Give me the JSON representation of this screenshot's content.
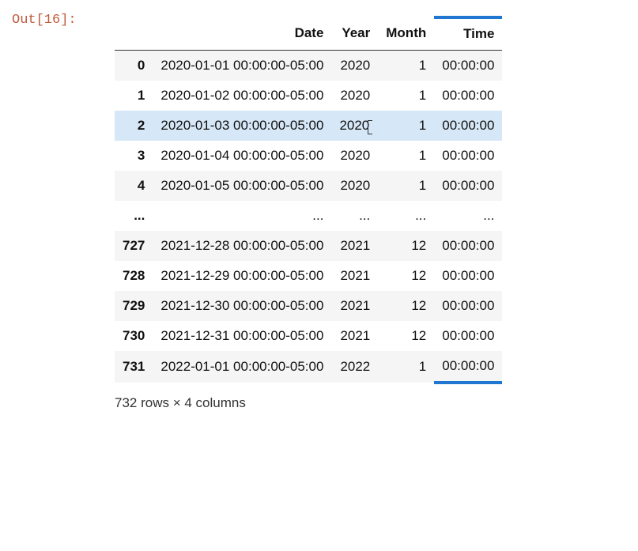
{
  "prompt": "Out[16]:",
  "chart_data": {
    "type": "table",
    "columns": [
      "",
      "Date",
      "Year",
      "Month",
      "Time"
    ],
    "rows": [
      {
        "idx": "0",
        "date": "2020-01-01 00:00:00-05:00",
        "year": "2020",
        "month": "1",
        "time": "00:00:00"
      },
      {
        "idx": "1",
        "date": "2020-01-02 00:00:00-05:00",
        "year": "2020",
        "month": "1",
        "time": "00:00:00"
      },
      {
        "idx": "2",
        "date": "2020-01-03 00:00:00-05:00",
        "year": "2020",
        "month": "1",
        "time": "00:00:00"
      },
      {
        "idx": "3",
        "date": "2020-01-04 00:00:00-05:00",
        "year": "2020",
        "month": "1",
        "time": "00:00:00"
      },
      {
        "idx": "4",
        "date": "2020-01-05 00:00:00-05:00",
        "year": "2020",
        "month": "1",
        "time": "00:00:00"
      },
      {
        "idx": "...",
        "date": "...",
        "year": "...",
        "month": "...",
        "time": "..."
      },
      {
        "idx": "727",
        "date": "2021-12-28 00:00:00-05:00",
        "year": "2021",
        "month": "12",
        "time": "00:00:00"
      },
      {
        "idx": "728",
        "date": "2021-12-29 00:00:00-05:00",
        "year": "2021",
        "month": "12",
        "time": "00:00:00"
      },
      {
        "idx": "729",
        "date": "2021-12-30 00:00:00-05:00",
        "year": "2021",
        "month": "12",
        "time": "00:00:00"
      },
      {
        "idx": "730",
        "date": "2021-12-31 00:00:00-05:00",
        "year": "2021",
        "month": "12",
        "time": "00:00:00"
      },
      {
        "idx": "731",
        "date": "2022-01-01 00:00:00-05:00",
        "year": "2022",
        "month": "1",
        "time": "00:00:00"
      }
    ],
    "highlight_row_index": 2,
    "highlight_column": "Time",
    "footer": "732 rows × 4 columns"
  }
}
